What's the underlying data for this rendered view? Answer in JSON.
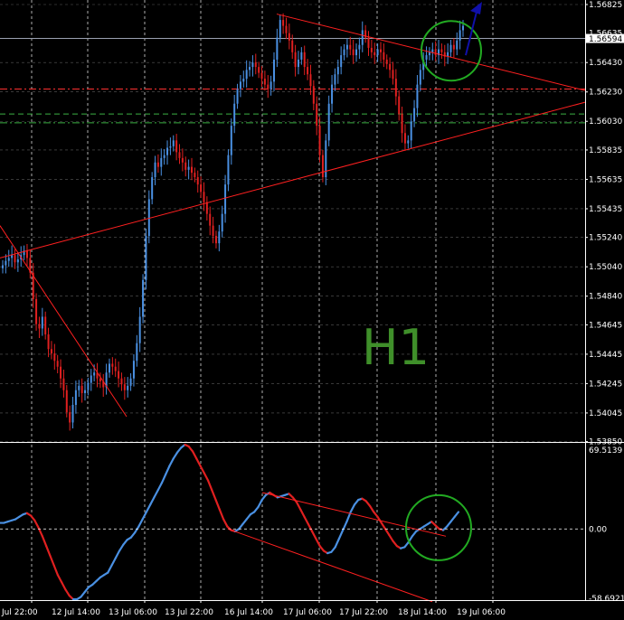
{
  "chart_data": [
    {
      "type": "candlestick",
      "timeframe_label": "H1",
      "xlabels": [
        "Jul 22:00",
        "12 Jul 14:00",
        "13 Jul 06:00",
        "13 Jul 22:00",
        "16 Jul 14:00",
        "17 Jul 06:00",
        "17 Jul 22:00",
        "18 Jul 14:00",
        "19 Jul 06:00"
      ],
      "ylim": [
        1.5386,
        1.56825
      ],
      "yticks": [
        "1.56825",
        "1.56430",
        "1.56230",
        "1.56030",
        "1.55835",
        "1.55635",
        "1.55435",
        "1.55240",
        "1.55040",
        "1.54840",
        "1.54645",
        "1.54445",
        "1.54245",
        "1.54045",
        "1.53850"
      ],
      "current_price": "1.56594",
      "current_price_partial": "1.56635",
      "levels": [
        {
          "value": 1.5625,
          "color": "#ff3030",
          "style": "dashdot"
        },
        {
          "value": 1.5608,
          "color": "#3cb043",
          "style": "dashed"
        },
        {
          "value": 1.5602,
          "color": "#3cb043",
          "style": "dashdot"
        }
      ],
      "colors": {
        "up": "#4a90e2",
        "down": "#e02020",
        "trend": "#ff2020",
        "circle": "#22aa22",
        "arrow": "#1010aa",
        "label": "#3f8f2a"
      },
      "close_series": [
        1.5505,
        1.5508,
        1.551,
        1.5512,
        1.5507,
        1.5509,
        1.5512,
        1.5515,
        1.551,
        1.55,
        1.5482,
        1.5465,
        1.5462,
        1.547,
        1.5458,
        1.5448,
        1.5445,
        1.544,
        1.5436,
        1.5428,
        1.542,
        1.5405,
        1.5398,
        1.541,
        1.542,
        1.5423,
        1.5418,
        1.542,
        1.5425,
        1.543,
        1.5432,
        1.5428,
        1.5426,
        1.5422,
        1.5432,
        1.5438,
        1.5436,
        1.5433,
        1.5428,
        1.5424,
        1.542,
        1.5423,
        1.5428,
        1.544,
        1.5452,
        1.547,
        1.5495,
        1.5525,
        1.555,
        1.5565,
        1.5575,
        1.5572,
        1.5578,
        1.558,
        1.5585,
        1.5586,
        1.559,
        1.5582,
        1.5578,
        1.5575,
        1.557,
        1.5572,
        1.5568,
        1.5565,
        1.556,
        1.5555,
        1.5548,
        1.554,
        1.5532,
        1.5525,
        1.552,
        1.5528,
        1.554,
        1.556,
        1.558,
        1.56,
        1.5615,
        1.5625,
        1.563,
        1.5632,
        1.5638,
        1.564,
        1.5643,
        1.564,
        1.5636,
        1.5632,
        1.5628,
        1.5625,
        1.563,
        1.5645,
        1.566,
        1.5672,
        1.5668,
        1.5663,
        1.5658,
        1.565,
        1.564,
        1.5645,
        1.565,
        1.564,
        1.5635,
        1.5627,
        1.5615,
        1.56,
        1.558,
        1.5565,
        1.559,
        1.5615,
        1.5628,
        1.5635,
        1.564,
        1.5648,
        1.5652,
        1.5655,
        1.5652,
        1.5648,
        1.5652,
        1.5655,
        1.5665,
        1.566,
        1.5653,
        1.565,
        1.5648,
        1.5652,
        1.565,
        1.5645,
        1.5642,
        1.5638,
        1.5632,
        1.562,
        1.5608,
        1.5595,
        1.5588,
        1.559,
        1.5603,
        1.5612,
        1.5628,
        1.5638,
        1.5645,
        1.5648,
        1.565,
        1.5652,
        1.5648,
        1.5652,
        1.565,
        1.5647,
        1.565,
        1.5655,
        1.5652,
        1.5658,
        1.5665,
        1.5668
      ]
    },
    {
      "type": "line",
      "name": "oscillator",
      "ylim": [
        -58.6921,
        69.5139
      ],
      "yticks": [
        "69.5139",
        "0.00",
        "-58.6921"
      ],
      "zero_label": "0.00",
      "colors": {
        "up": "#4a90e2",
        "down": "#e02020",
        "trend": "#ff2020"
      },
      "values": [
        5,
        5,
        6,
        7,
        8,
        10,
        12,
        13,
        11,
        7,
        1,
        -6,
        -14,
        -22,
        -30,
        -38,
        -44,
        -50,
        -55,
        -58,
        -58,
        -56,
        -52,
        -48,
        -46,
        -43,
        -40,
        -38,
        -36,
        -30,
        -24,
        -18,
        -13,
        -9,
        -7,
        -3,
        2,
        8,
        14,
        20,
        26,
        32,
        38,
        45,
        52,
        58,
        63,
        67,
        69.5,
        68,
        64,
        58,
        52,
        46,
        40,
        32,
        24,
        16,
        8,
        2,
        -1,
        -2,
        0,
        4,
        8,
        12,
        14,
        18,
        24,
        28,
        30,
        28,
        26,
        27,
        28,
        29,
        26,
        22,
        16,
        10,
        4,
        -2,
        -8,
        -14,
        -18,
        -20,
        -19,
        -15,
        -8,
        -1,
        6,
        14,
        20,
        24,
        25,
        23,
        19,
        14,
        10,
        5,
        0,
        -5,
        -10,
        -14,
        -16,
        -15,
        -11,
        -6,
        -2,
        0,
        2,
        4,
        6,
        3,
        0,
        -1,
        2,
        6,
        10,
        14
      ]
    }
  ]
}
